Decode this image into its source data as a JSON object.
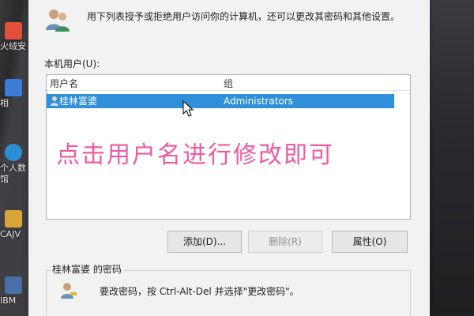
{
  "desktop": {
    "icons": [
      {
        "label": "火绒安",
        "color": "#e24f3a"
      },
      {
        "label": "相",
        "color": "#3b7dd8"
      },
      {
        "label": "个人数",
        "color": "#2c8fd6"
      },
      {
        "label": "馆",
        "color": "#2c8fd6"
      },
      {
        "label": "CAJV",
        "color": "#d9a43a"
      },
      {
        "label": "IBM",
        "color": "#4a6fa8"
      }
    ]
  },
  "dialog": {
    "intro_text": "用下列表授予或拒绝用户访问你的计算机，还可以更改其密码和其他设置。",
    "users_label": "本机用户(U):",
    "list": {
      "columns": [
        "用户名",
        "组"
      ],
      "rows": [
        {
          "name": "桂林富婆",
          "group": "Administrators",
          "selected": true
        }
      ]
    },
    "overlay_annotation": "点击用户名进行修改即可",
    "buttons": {
      "add": "添加(D)...",
      "remove": "删除(R)",
      "properties": "属性(O)"
    },
    "password_group_label": "桂林富婆 的密码",
    "password_hint": "要改密码，按 Ctrl-Alt-Del 并选择\"更改密码\"。"
  },
  "colors": {
    "selection": "#2f8fd8",
    "annotation": "#f05aa0"
  }
}
